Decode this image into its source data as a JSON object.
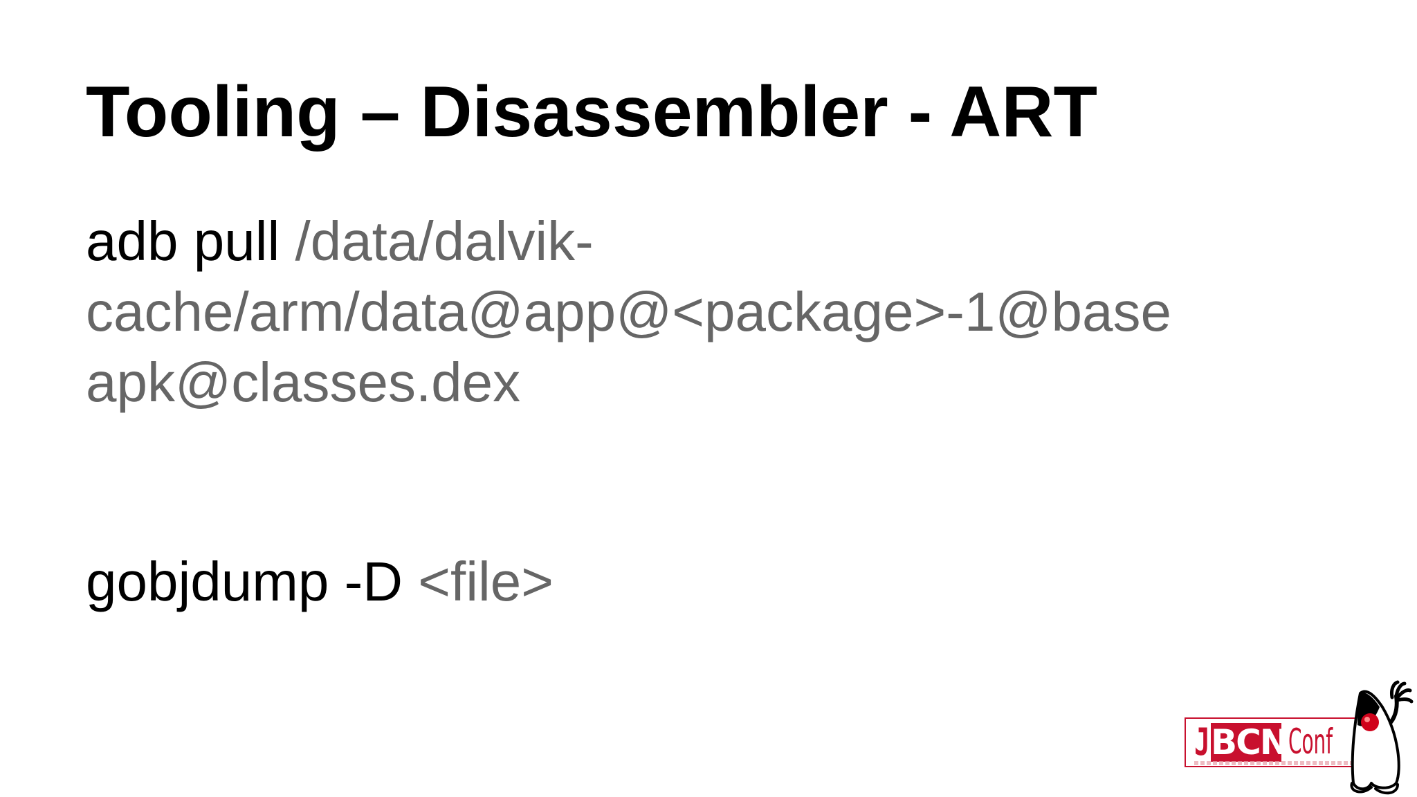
{
  "slide": {
    "title": "Tooling – Disassembler - ART",
    "command1": {
      "command": "adb pull",
      "argument": "/data/dalvik-cache/arm/data@app@<package>-1@base apk@classes.dex"
    },
    "command2": {
      "command": "gobjdump -D",
      "argument": "<file>"
    }
  },
  "logo": {
    "j": "J",
    "bcn": "BCN",
    "conf": "Conf",
    "icon": "duke-mascot-icon",
    "brand_color": "#c8102e"
  }
}
